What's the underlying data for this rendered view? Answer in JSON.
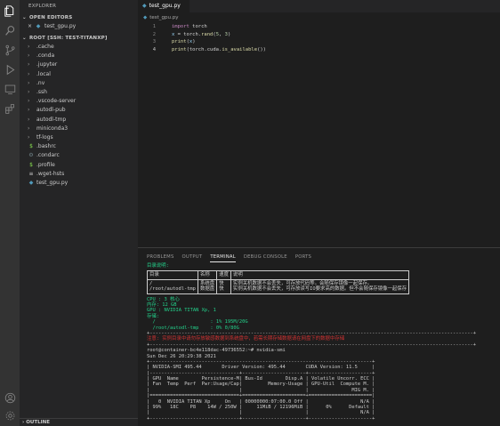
{
  "explorer": {
    "title": "EXPLORER",
    "open_editors": "OPEN EDITORS",
    "open_files": [
      "test_gpu.py"
    ],
    "root": "ROOT [SSH: TEST-TITANXP]",
    "items": [
      {
        "label": ".cache",
        "kind": "folder"
      },
      {
        "label": ".conda",
        "kind": "folder"
      },
      {
        "label": ".jupyter",
        "kind": "folder"
      },
      {
        "label": ".local",
        "kind": "folder"
      },
      {
        "label": ".nv",
        "kind": "folder"
      },
      {
        "label": ".ssh",
        "kind": "folder"
      },
      {
        "label": ".vscode-server",
        "kind": "folder"
      },
      {
        "label": "autodl-pub",
        "kind": "folder"
      },
      {
        "label": "autodl-tmp",
        "kind": "folder"
      },
      {
        "label": "miniconda3",
        "kind": "folder"
      },
      {
        "label": "tf-logs",
        "kind": "folder"
      },
      {
        "label": ".bashrc",
        "kind": "shell"
      },
      {
        "label": ".condarc",
        "kind": "settings"
      },
      {
        "label": ".profile",
        "kind": "shell"
      },
      {
        "label": ".wget-hsts",
        "kind": "file"
      },
      {
        "label": "test_gpu.py",
        "kind": "python"
      }
    ],
    "outline": "OUTLINE"
  },
  "editor": {
    "tab_label": "test_gpu.py",
    "breadcrumb": "test_gpu.py",
    "lines": [
      {
        "n": "1",
        "parts": [
          [
            "kw",
            "import"
          ],
          [
            "plain",
            " torch"
          ]
        ]
      },
      {
        "n": "2",
        "parts": [
          [
            "var",
            "x"
          ],
          [
            "plain",
            " = torch."
          ],
          [
            "fn",
            "rand"
          ],
          [
            "plain",
            "("
          ],
          [
            "num",
            "5"
          ],
          [
            "plain",
            ", "
          ],
          [
            "num",
            "3"
          ],
          [
            "plain",
            ")"
          ]
        ]
      },
      {
        "n": "3",
        "parts": [
          [
            "fn",
            "print"
          ],
          [
            "plain",
            "("
          ],
          [
            "var",
            "x"
          ],
          [
            "plain",
            ")"
          ]
        ]
      },
      {
        "n": "4",
        "parts": [
          [
            "fn",
            "print"
          ],
          [
            "plain",
            "(torch.cuda."
          ],
          [
            "fn",
            "is_available"
          ],
          [
            "plain",
            "())"
          ]
        ]
      }
    ]
  },
  "panel": {
    "tabs": [
      "PROBLEMS",
      "OUTPUT",
      "TERMINAL",
      "DEBUG CONSOLE",
      "PORTS"
    ],
    "active_tab": "TERMINAL"
  },
  "terminal": {
    "heading": "目录说明:",
    "table_header": [
      "目录",
      "名称",
      "速度",
      "说明"
    ],
    "table_row": {
      "dir": "/\n/root/autodl-tmp",
      "name": "系统盘\n数据盘",
      "speed": "快\n快",
      "desc": "实例关机数据不会丢失，可存放代码等。会随保存镜像一起保存。\n实例关机数据不会丢失，可存放读写IO要求高的数据。但不会随保存镜像一起保存"
    },
    "info": [
      "CPU : 3 核心",
      "内存: 12 GB",
      "GPU : NVIDIA TITAN Xp, 1",
      "存储:"
    ],
    "disk_1": "  /                   : 1% 195M/20G",
    "disk_2": "  /root/autodl-tmp    : 0% 0/80G",
    "rule": "+----------------------------------------------------------------------------------------------------------------+",
    "warning": "注意: 实例目录中请勿存放敏感数据到系统盘中，若需长期存储数据请在网盘下的数据中存储",
    "prompt": "root@container-bc4e118dac-49736552:~# nvidia-smi",
    "date": "Sun Dec 26 20:29:38 2021",
    "smi": [
      "+-----------------------------------------------------------------------------+",
      "| NVIDIA-SMI 495.44       Driver Version: 495.44       CUDA Version: 11.5     |",
      "|-------------------------------+----------------------+----------------------+",
      "| GPU  Name        Persistence-M| Bus-Id        Disp.A | Volatile Uncorr. ECC |",
      "| Fan  Temp  Perf  Pwr:Usage/Cap|         Memory-Usage | GPU-Util  Compute M. |",
      "|                               |                      |               MIG M. |",
      "|===============================+======================+======================|",
      "|   0  NVIDIA TITAN Xp     On   | 00000000:07:00.0 Off |                  N/A |",
      "| 99%   18C    P8    14W / 250W |     11MiB / 12196MiB |      0%      Default |",
      "|                               |                      |                  N/A |",
      "+-------------------------------+----------------------+----------------------+"
    ]
  }
}
